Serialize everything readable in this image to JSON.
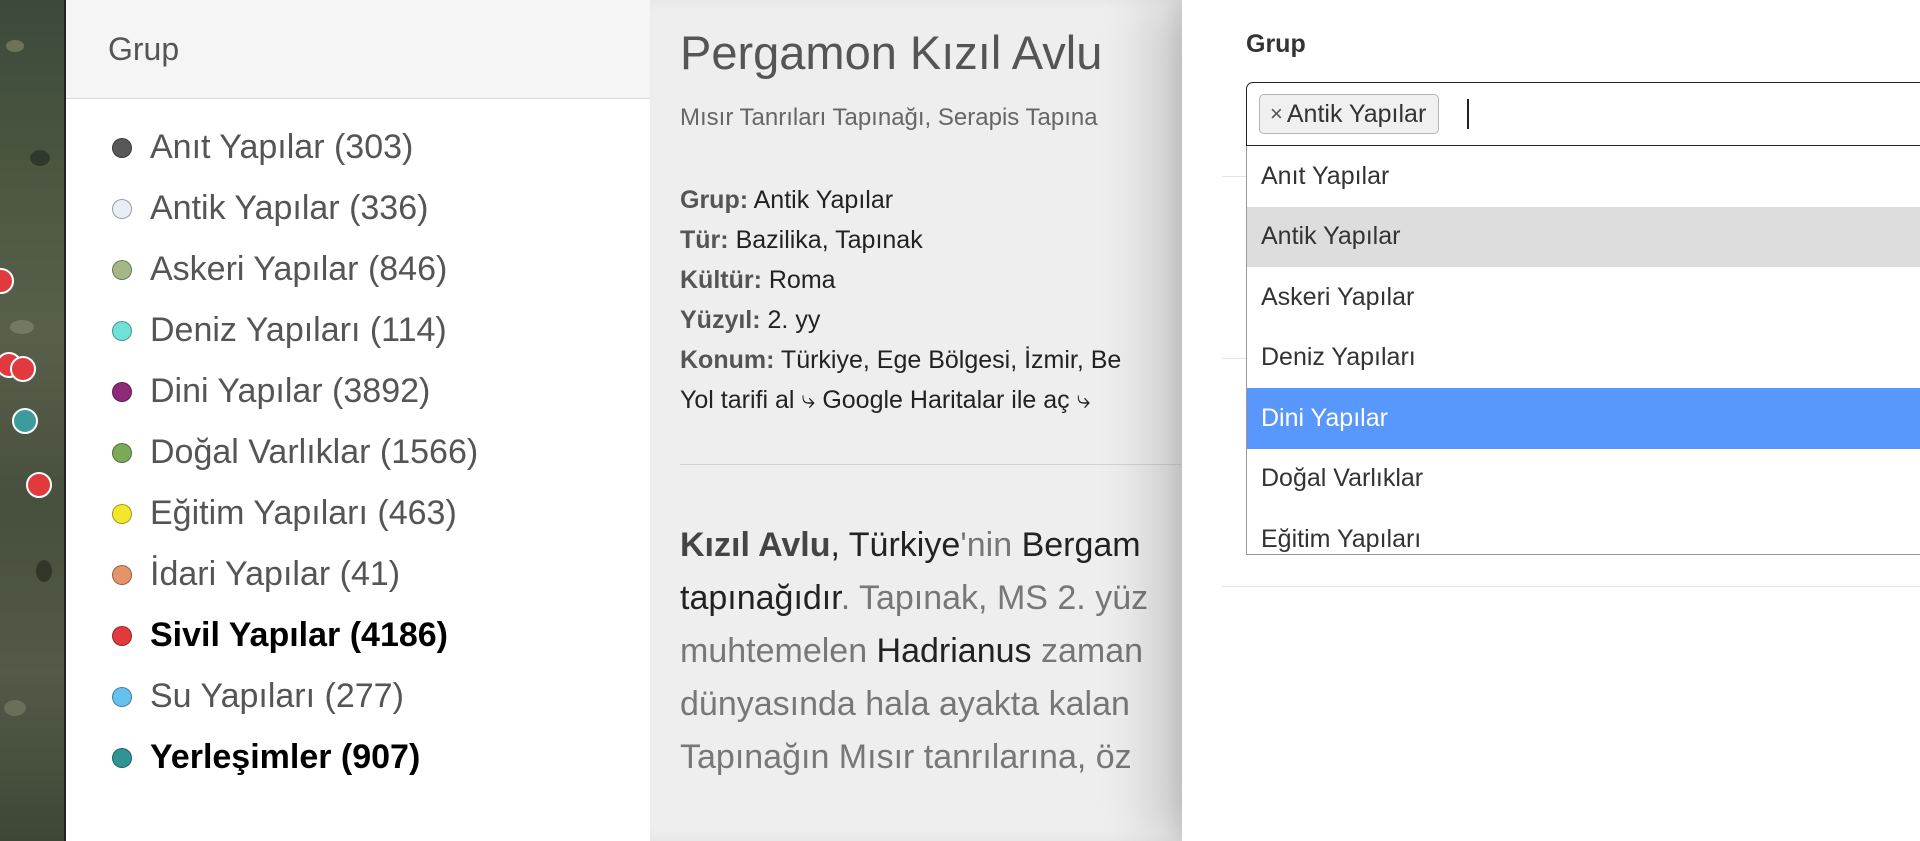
{
  "map": {
    "marker_colors": [
      "#e03a3e",
      "#e03a3e",
      "#3d9c9b",
      "#e03a3e",
      "#e03a3e"
    ]
  },
  "legend": {
    "title": "Grup",
    "items": [
      {
        "label": "Anıt Yapılar (303)",
        "color": "#585858",
        "bold": false
      },
      {
        "label": "Antik Yapılar (336)",
        "color": "#e8eef8",
        "bold": false
      },
      {
        "label": "Askeri Yapılar (846)",
        "color": "#a3b787",
        "bold": false
      },
      {
        "label": "Deniz Yapıları (114)",
        "color": "#6ee2d7",
        "bold": false
      },
      {
        "label": "Dini Yapılar (3892)",
        "color": "#8e2a78",
        "bold": false
      },
      {
        "label": "Doğal Varlıklar (1566)",
        "color": "#7ca957",
        "bold": false
      },
      {
        "label": "Eğitim Yapıları (463)",
        "color": "#f4e62a",
        "bold": false
      },
      {
        "label": "İdari Yapılar (41)",
        "color": "#e4936a",
        "bold": false
      },
      {
        "label": "Sivil Yapılar (4186)",
        "color": "#e03a3e",
        "bold": true
      },
      {
        "label": "Su Yapıları (277)",
        "color": "#66c1ee",
        "bold": false
      },
      {
        "label": "Yerleşimler (907)",
        "color": "#2e9593",
        "bold": true
      }
    ]
  },
  "detail": {
    "title": "Pergamon Kızıl Avlu",
    "subtitle": "Mısır Tanrıları Tapınağı, Serapis Tapına",
    "meta": {
      "group_key": "Grup:",
      "group_val": "Antik Yapılar",
      "type_key": "Tür:",
      "type_val": "Bazilika, Tapınak",
      "culture_key": "Kültür:",
      "culture_val": "Roma",
      "century_key": "Yüzyıl:",
      "century_val": "2. yy",
      "location_key": "Konum:",
      "location_val": "Türkiye, Ege Bölgesi, İzmir, Be",
      "directions_link": "Yol tarifi al ⤷",
      "maps_link": "Google Haritalar ile aç ⤷"
    },
    "body": {
      "l1_a": "Kızıl Avlu",
      "l1_b": ", ",
      "l1_c": "Türkiye",
      "l1_d": "'nin ",
      "l1_e": "Bergam",
      "l2_a": "tapınağıdır",
      "l2_b": ". Tapınak, MS 2. yüz",
      "l3_a": "muhtemelen ",
      "l3_b": "Hadrianus",
      "l3_c": " zaman",
      "l4": "dünyasında hala ayakta kalan",
      "l5": "Tapınağın Mısır tanrılarına, öz"
    }
  },
  "form": {
    "label": "Grup",
    "chip_remove": "×",
    "chip_label": "Antik Yapılar",
    "options": [
      {
        "label": "Anıt Yapılar",
        "state": ""
      },
      {
        "label": "Antik Yapılar",
        "state": "selected"
      },
      {
        "label": "Askeri Yapılar",
        "state": ""
      },
      {
        "label": "Deniz Yapıları",
        "state": ""
      },
      {
        "label": "Dini Yapılar",
        "state": "highlighted"
      },
      {
        "label": "Doğal Varlıklar",
        "state": ""
      },
      {
        "label": "Eğitim Yapıları",
        "state": ""
      }
    ]
  }
}
